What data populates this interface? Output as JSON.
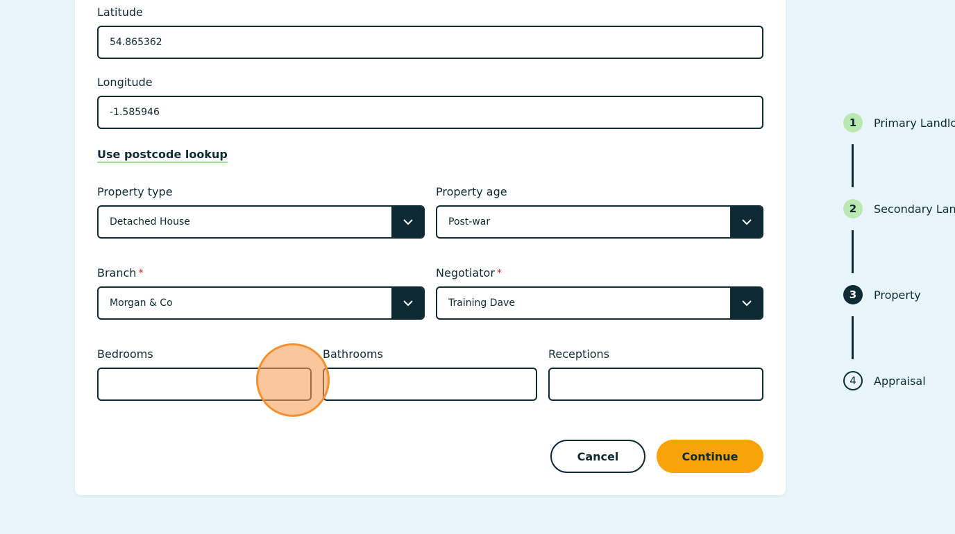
{
  "form": {
    "latitude": {
      "label": "Latitude",
      "value": "54.865362"
    },
    "longitude": {
      "label": "Longitude",
      "value": "-1.585946"
    },
    "postcode_link": "Use postcode lookup",
    "property_type": {
      "label": "Property type",
      "value": "Detached House"
    },
    "property_age": {
      "label": "Property age",
      "value": "Post-war"
    },
    "branch": {
      "label": "Branch",
      "required_mark": "*",
      "value": "Morgan & Co"
    },
    "negotiator": {
      "label": "Negotiator",
      "required_mark": "*",
      "value": "Training Dave"
    },
    "bedrooms": {
      "label": "Bedrooms",
      "value": ""
    },
    "bathrooms": {
      "label": "Bathrooms",
      "value": ""
    },
    "receptions": {
      "label": "Receptions",
      "value": ""
    }
  },
  "actions": {
    "cancel_label": "Cancel",
    "continue_label": "Continue"
  },
  "stepper": {
    "steps": [
      {
        "number": "1",
        "label": "Primary Landlo",
        "state": "done"
      },
      {
        "number": "2",
        "label": "Secondary Lan",
        "state": "done"
      },
      {
        "number": "3",
        "label": "Property",
        "state": "active"
      },
      {
        "number": "4",
        "label": "Appraisal",
        "state": "todo"
      }
    ]
  },
  "colors": {
    "background": "#e8f6fb",
    "primary": "#0e2a33",
    "accent": "#f9a30b",
    "done_step": "#b9e8b0",
    "required": "#d32020"
  },
  "icons": {
    "dropdown": "chevron-down-icon"
  }
}
